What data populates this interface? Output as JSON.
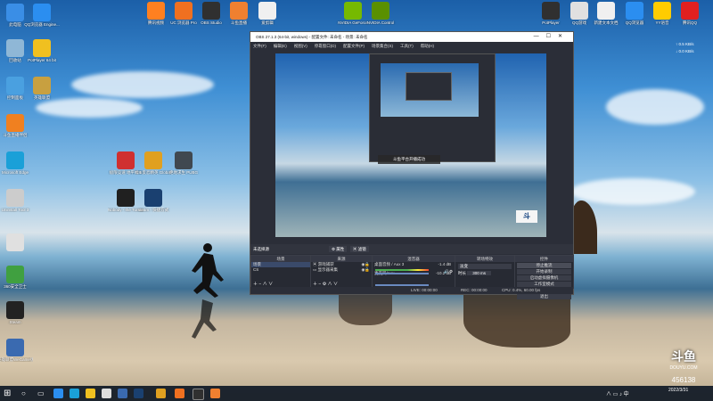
{
  "desktop_icons": [
    {
      "name": "this-pc",
      "label": "此电脑",
      "color": "#3a8ee6"
    },
    {
      "name": "qq-manager",
      "label": "QQ浏览器 Engine...",
      "color": "#2b8ef0"
    },
    {
      "name": "recycle-bin",
      "label": "回收站",
      "color": "#8fb7d6"
    },
    {
      "name": "potplayer",
      "label": "PotPlayer 64 bit",
      "color": "#f0c020"
    },
    {
      "name": "control-panel",
      "label": "控制面板",
      "color": "#4aa0e0"
    },
    {
      "name": "lol",
      "label": "英雄联盟",
      "color": "#c8a040"
    },
    {
      "name": "douyu-helper",
      "label": "斗鱼直播伴侣",
      "color": "#f08020"
    },
    {
      "name": "edge",
      "label": "Microsoft Edge",
      "color": "#1aa0d8"
    },
    {
      "name": "uninstaller",
      "label": "Uninstall Tool 3",
      "color": "#cccccc"
    },
    {
      "name": "folder",
      "label": "",
      "color": "#e0e0e0"
    },
    {
      "name": "360",
      "label": "360安全卫士",
      "color": "#40a040"
    },
    {
      "name": "steam-icon-left",
      "label": "Steam",
      "color": "#222222"
    },
    {
      "name": "lol2",
      "label": "英雄联盟WeGame版",
      "color": "#3a6ab0"
    }
  ],
  "center_icons": [
    {
      "label": "极限竞速 地平线 5",
      "color": "#d03030"
    },
    {
      "label": "CS 反恐精英 Global Offe...",
      "color": "#e0a020"
    },
    {
      "label": "绝地求生 PUBG",
      "color": "#404850"
    },
    {
      "label": "Nobody - the Turnaro...",
      "color": "#202020"
    },
    {
      "label": "steam - 快捷方式",
      "color": "#1a4070"
    }
  ],
  "top_icons": [
    {
      "label": "腾讯视频",
      "color": "#ff8020"
    },
    {
      "label": "UC 浏览器 Pro",
      "color": "#f07020"
    },
    {
      "label": "OBS Studio",
      "color": "#303030"
    },
    {
      "label": "斗鱼直播",
      "color": "#f08030"
    },
    {
      "label": "爱剪辑",
      "color": "#f0f0f0"
    },
    {
      "label": "NVIDIA GeForce",
      "color": "#76b900"
    },
    {
      "label": "NVIDIA Control",
      "color": "#5a9000"
    },
    {
      "label": "PotPlayer",
      "color": "#303030"
    },
    {
      "label": "QQ游戏",
      "color": "#e0e0e0"
    },
    {
      "label": "新建文本文档",
      "color": "#f0f0f0"
    },
    {
      "label": "QQ浏览器",
      "color": "#2b8ef0"
    },
    {
      "label": "YY语音",
      "color": "#ffcc00"
    },
    {
      "label": "腾讯QQ",
      "color": "#e02020"
    }
  ],
  "net_speed": {
    "up": "0.5 KB/s",
    "down": "0.0 KB/s"
  },
  "obs": {
    "title": "OBS 27.1.3 (64-bit, windows) - 配置文件: 未命名 - 场景: 未命名",
    "menu": [
      "文件(F)",
      "编辑(E)",
      "视图(V)",
      "停靠窗口(D)",
      "配置文件(P)",
      "场景集合(S)",
      "工具(T)",
      "帮助(H)"
    ],
    "no_source": "未选择源",
    "props_btn": "属性",
    "filters_btn": "滤镜",
    "toast": "斗鱼平台开播成功",
    "docks": {
      "scenes": {
        "title": "场景",
        "items": [
          "场景",
          "CS"
        ]
      },
      "sources": {
        "title": "来源",
        "items": [
          "游戏捕获",
          "显示器采集"
        ]
      },
      "mixer": {
        "title": "混音器",
        "ch1": "桌面音频 / Aux 3",
        "ch1_db": "-1.4 dB",
        "ch2": "麦克风/Aux",
        "ch2_db": "-10.2 dB"
      },
      "transitions": {
        "title": "转场特效",
        "type": "淡变",
        "duration_label": "时长",
        "duration": "300 ms"
      },
      "controls": {
        "title": "控件",
        "buttons": [
          "停止推流",
          "开始录制",
          "启动虚拟摄像机",
          "工作室模式",
          "设置",
          "退出"
        ]
      }
    },
    "status": {
      "live": "LIVE: 00:00:00",
      "rec": "REC: 00:00:00",
      "cpu": "CPU: 0.4%, 60.00 fps"
    }
  },
  "watermark": {
    "brand": "斗鱼",
    "brand_en": "DOUYU.COM",
    "room": "456138"
  },
  "clock": {
    "time": "",
    "date": "2022/3/31"
  }
}
